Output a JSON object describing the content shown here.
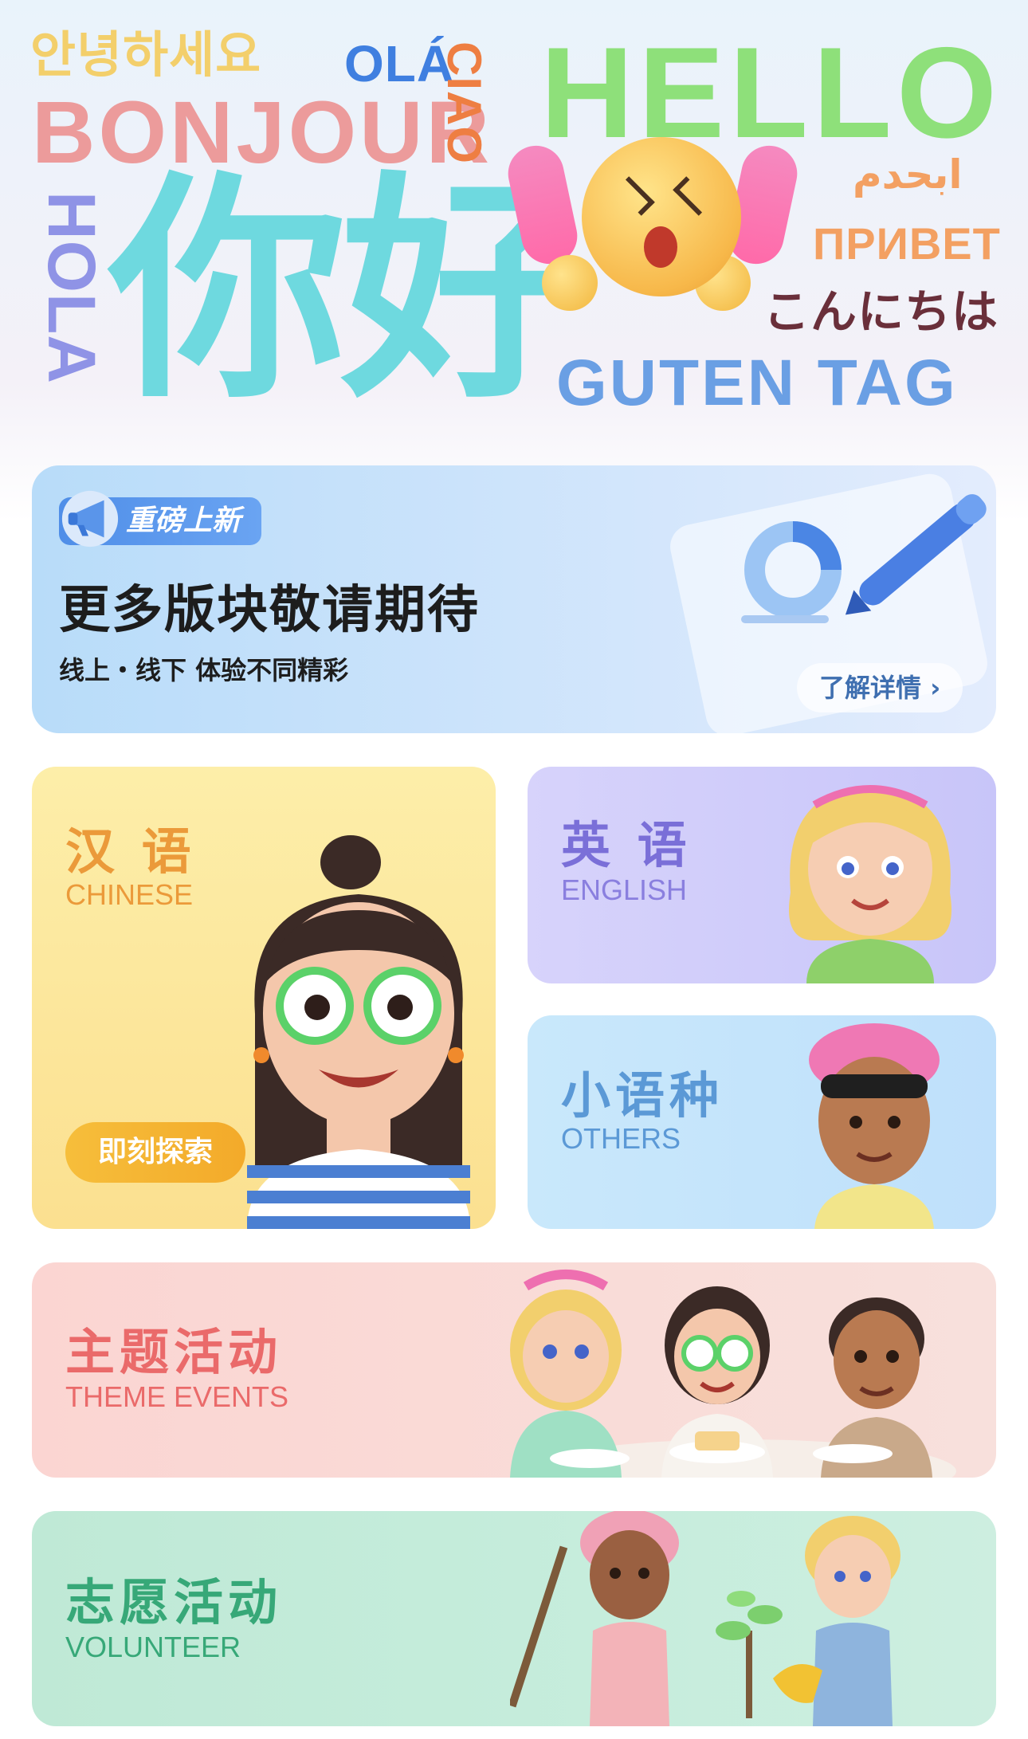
{
  "hero": {
    "words": {
      "korean": "안녕하세요",
      "ola": "OLÁ",
      "bonjour": "BONJOUR",
      "ciao": "CIAO",
      "hello": "HELLO",
      "hola": "HOLA",
      "nihao": "你好",
      "arabic": "ابحدم",
      "privet": "ПРИВЕТ",
      "konnichiwa": "こんにちは",
      "guten_tag": "GUTEN TAG"
    },
    "emoji_icon": "shocked-face-with-exclamation-icon"
  },
  "banner": {
    "badge": "重磅上新",
    "title": "更多版块敬请期待",
    "subtitle": "线上・线下  体验不同精彩",
    "detail_button": "了解详情 ›",
    "icons": [
      "megaphone-icon",
      "pen-icon",
      "document-icon"
    ]
  },
  "cards": {
    "chinese": {
      "title": "汉 语",
      "subtitle": "CHINESE",
      "button": "即刻探索"
    },
    "english": {
      "title": "英 语",
      "subtitle": "ENGLISH"
    },
    "others": {
      "title": "小语种",
      "subtitle": "OTHERS"
    },
    "theme": {
      "title": "主题活动",
      "subtitle": "THEME EVENTS"
    },
    "volunteer": {
      "title": "志愿活动",
      "subtitle": "VOLUNTEER"
    }
  },
  "colors": {
    "chinese_accent": "#eb9a3a",
    "english_accent": "#7a6fd8",
    "others_accent": "#5b99d6",
    "theme_accent": "#ea6a6a",
    "volunteer_accent": "#37a878",
    "banner_badge": "#4f8ee8"
  }
}
